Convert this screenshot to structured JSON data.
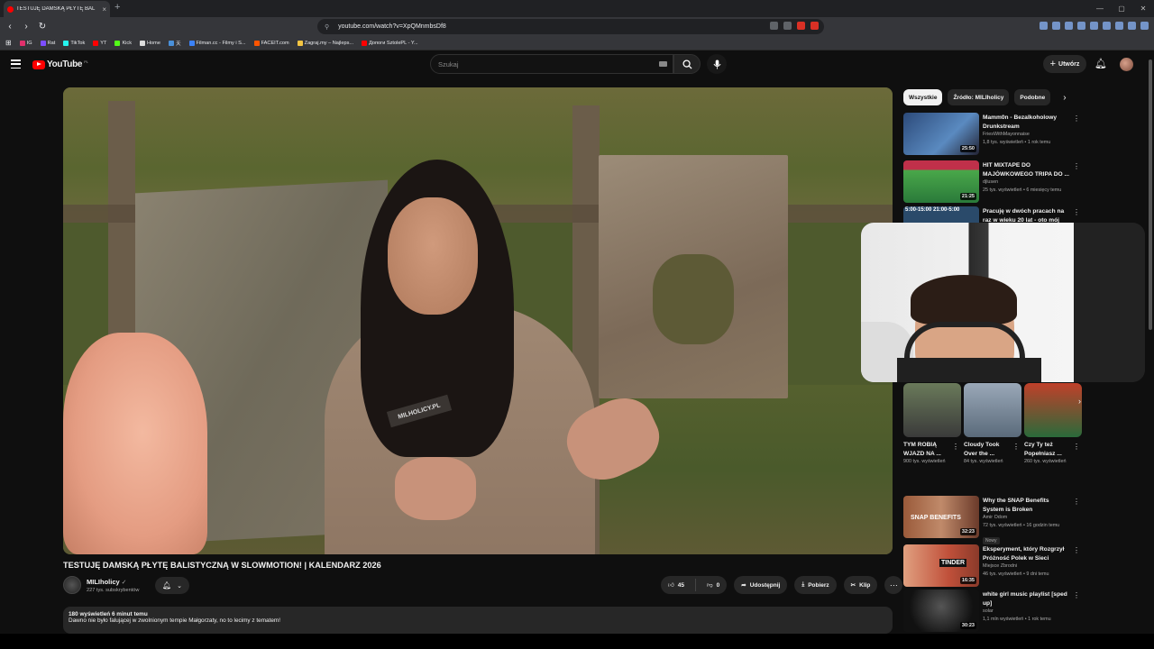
{
  "browser": {
    "tab_title": "TESTUJĘ DAMSKĄ PŁYTĘ BAL",
    "tab_close": "×",
    "new_tab": "+",
    "url": "youtube.com/watch?v=XpQMnmbsDf8",
    "window_controls": [
      "—",
      "▢",
      "✕"
    ],
    "bookmarks": [
      {
        "label": "IG",
        "color": "#e1306c"
      },
      {
        "label": "Rat",
        "color": "#7c4dff"
      },
      {
        "label": "TikTok",
        "color": "#25f4ee"
      },
      {
        "label": "YT",
        "color": "#ff0000"
      },
      {
        "label": "Kick",
        "color": "#53fc18"
      },
      {
        "label": "Home",
        "color": "#dddddd"
      },
      {
        "label": "天",
        "color": "#4a90d9"
      },
      {
        "label": "Filman.cc - Filmy i S...",
        "color": "#3b82f6"
      },
      {
        "label": "FACEIT.com",
        "color": "#ff5500"
      },
      {
        "label": "Zagraj.my – Najleps...",
        "color": "#f4c542"
      },
      {
        "label": "Допоги SztolePL - Y...",
        "color": "#ff0000"
      }
    ]
  },
  "youtube": {
    "logo_text": "YouTube",
    "logo_region": "PL",
    "search_placeholder": "Szukaj",
    "create_label": "Utwórz"
  },
  "video": {
    "title": "TESTUJĘ DAMSKĄ PŁYTĘ BALISTYCZNĄ W SLOWMOTION! | KALENDARZ 2026",
    "shirt_print": "MILHOLICY.PL",
    "channel_name": "MILIholicy",
    "channel_verified": "✓",
    "subscribers": "227 tys. subskrybentów",
    "likes": "45",
    "dislikes": "0",
    "share_label": "Udostępnij",
    "download_label": "Pobierz",
    "clip_label": "Klip",
    "more_label": "⋯",
    "desc_meta": "180 wyświetleń  6 minut temu",
    "desc_text": "Dawno nie było falującej w zwolnionym tempie Małgorzaty, no to lecimy z tematem!"
  },
  "sidebar": {
    "chips": [
      "Wszystkie",
      "Źródło: MILIholicy",
      "Podobne"
    ],
    "chip_next": "›",
    "recs_top": [
      {
        "title": "Mamm0n - Bezalkoholowy Drunkstream",
        "channel": "FriesWithMayonnaise",
        "meta": "1,8 tys. wyświetleń • 1 rok temu",
        "duration": "25:50",
        "thumb": "#3a5a8a"
      },
      {
        "title": "HIT MIXTAPE DO MAJÓWKOWEGO TRIPA DO ...",
        "channel": "djlusen",
        "meta": "25 tys. wyświetleń • 6 miesięcy temu",
        "duration": "21:25",
        "thumb": "#3a9a3a"
      },
      {
        "title": "Pracuję w dwóch pracach na raz w wieku 20 lat - oto mój dzień",
        "channel": "",
        "meta": "",
        "duration": "",
        "thumb": "#2a4a6a",
        "overlay": "5:00-15:00   21:00-5:00"
      }
    ],
    "shorts": [
      {
        "title": "TYM ROBIĄ WJAZD NA ...",
        "views": "900 tys. wyświetleń",
        "thumb": "#5a5a5a"
      },
      {
        "title": "Cloudy Took Over the ...",
        "views": "84 tys. wyświetleń",
        "thumb": "#7a8a9a"
      },
      {
        "title": "Czy Ty też Popełniasz ...",
        "views": "260 tys. wyświetleń",
        "thumb": "#b03a2a"
      }
    ],
    "recs_bottom": [
      {
        "title": "Why the SNAP Benefits System is Broken",
        "channel": "Amir Odom",
        "meta": "72 tys. wyświetleń • 16 godzin temu",
        "duration": "32:23",
        "thumb": "#8a4a2a",
        "badge": "Nowy",
        "overlay": "SNAP BENEFITS"
      },
      {
        "title": "Eksperyment, który Rozgrzył Próżność Polek w Sieci",
        "channel": "Miejsce Zbrodni",
        "meta": "46 tys. wyświetleń • 9 dni temu",
        "duration": "16:35",
        "thumb": "#c0503a",
        "overlay": "TINDER"
      },
      {
        "title": "white girl music playlist [sped up]",
        "channel": "solar",
        "meta": "1,1 mln wyświetleń • 1 rok temu",
        "duration": "30:23",
        "thumb": "#1a1a1a"
      }
    ]
  }
}
